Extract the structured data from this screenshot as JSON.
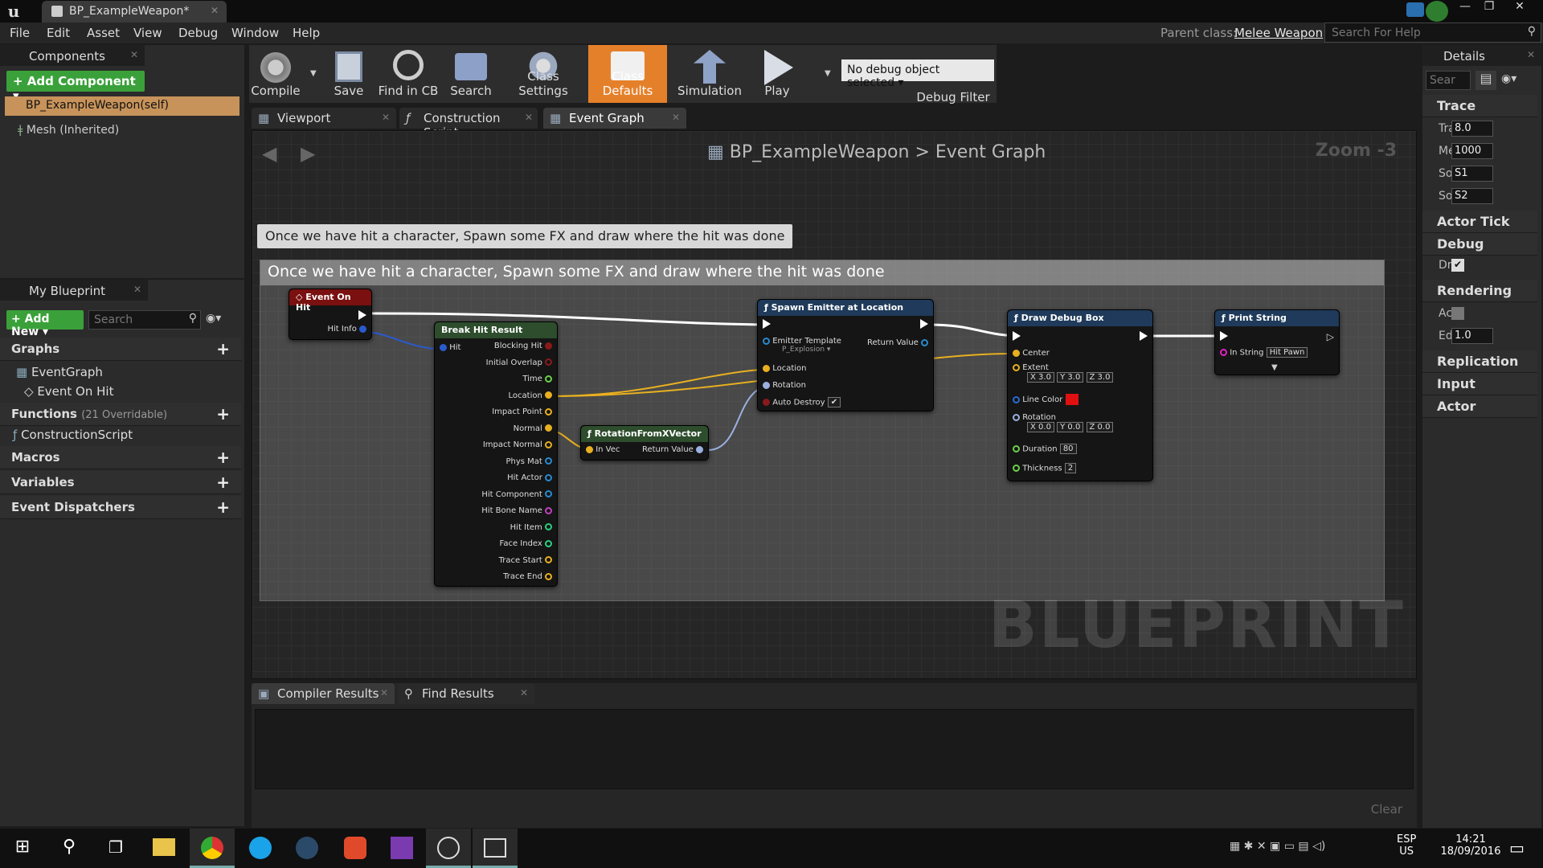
{
  "window": {
    "tab_title": "BP_ExampleWeapon*"
  },
  "menu": [
    "File",
    "Edit",
    "Asset",
    "View",
    "Debug",
    "Window",
    "Help"
  ],
  "header": {
    "parent_label": "Parent class:",
    "parent_value": "Melee Weapon",
    "search_placeholder": "Search For Help"
  },
  "components": {
    "tab": "Components",
    "add_button": "+ Add Component ▾",
    "self_item": "BP_ExampleWeapon(self)",
    "mesh_item": "Mesh (Inherited)"
  },
  "my_blueprint": {
    "tab": "My Blueprint",
    "add_new": "+ Add New ▾",
    "search_placeholder": "Search",
    "graphs": "Graphs",
    "eventgraph": "EventGraph",
    "event_on_hit": "Event On Hit",
    "functions": "Functions",
    "functions_hint": "(21 Overridable)",
    "construction": "ConstructionScript",
    "macros": "Macros",
    "variables": "Variables",
    "dispatchers": "Event Dispatchers"
  },
  "toolbar": {
    "compile": "Compile",
    "save": "Save",
    "find_in_cb": "Find in CB",
    "search": "Search",
    "class_settings": "Class Settings",
    "class_defaults": "Class Defaults",
    "simulation": "Simulation",
    "play": "Play",
    "debug_select": "No debug object selected ▾",
    "debug_filter": "Debug Filter"
  },
  "editor_tabs": [
    "Viewport",
    "Construction Script",
    "Event Graph"
  ],
  "graph": {
    "crumb_bp": "BP_ExampleWeapon",
    "crumb_sep": ">",
    "crumb_graph": "Event Graph",
    "zoom": "Zoom -3",
    "comment": "Once we have hit a character, Spawn some FX and draw where the hit was done",
    "watermark": "BLUEPRINT"
  },
  "nodes": {
    "event_on_hit": {
      "title": "Event On Hit",
      "hit_info": "Hit Info"
    },
    "break_hit": {
      "title": "Break Hit Result",
      "in": "Hit",
      "outs": [
        "Blocking Hit",
        "Initial Overlap",
        "Time",
        "Location",
        "Impact Point",
        "Normal",
        "Impact Normal",
        "Phys Mat",
        "Hit Actor",
        "Hit Component",
        "Hit Bone Name",
        "Hit Item",
        "Face Index",
        "Trace Start",
        "Trace End"
      ]
    },
    "rotation": {
      "title": "RotationFromXVector",
      "in": "In Vec",
      "out": "Return Value"
    },
    "spawn": {
      "title": "Spawn Emitter at Location",
      "emitter": "Emitter Template",
      "emitter_val": "P_Explosion ▾",
      "return": "Return Value",
      "location": "Location",
      "rotation": "Rotation",
      "auto": "Auto Destroy"
    },
    "debug_box": {
      "title": "Draw Debug Box",
      "center": "Center",
      "extent": "Extent",
      "extent_vals": [
        "X 3.0",
        "Y 3.0",
        "Z 3.0"
      ],
      "line_color": "Line Color",
      "rotation": "Rotation",
      "rot_vals": [
        "X 0.0",
        "Y 0.0",
        "Z 0.0"
      ],
      "duration": "Duration",
      "duration_val": "80",
      "thickness": "Thickness",
      "thickness_val": "2"
    },
    "print": {
      "title": "Print String",
      "in_string": "In String",
      "in_string_val": "Hit Pawn"
    }
  },
  "bottom": {
    "tabs": [
      "Compiler Results",
      "Find Results"
    ],
    "clear": "Clear"
  },
  "details": {
    "tab": "Details",
    "search_placeholder": "Sear",
    "trace": "Trace",
    "props": [
      {
        "label": "Tra",
        "value": "8.0"
      },
      {
        "label": "Mel",
        "value": "1000"
      },
      {
        "label": "Soc",
        "value": "S1"
      },
      {
        "label": "Soc",
        "value": "S2"
      }
    ],
    "actor_tick": "Actor Tick",
    "debug": "Debug",
    "debug_prop": "Dra",
    "rendering": "Rendering",
    "act": "Act",
    "edit": "Edit",
    "edit_val": "1.0",
    "replication": "Replication",
    "input": "Input",
    "actor": "Actor"
  },
  "taskbar": {
    "lang1": "ESP",
    "lang2": "US",
    "time": "14:21",
    "date": "18/09/2016"
  },
  "colors": {
    "accent": "#e5802a",
    "green": "#3aa13a",
    "event_red": "#7a1010",
    "func_blue": "#1f3a5a"
  }
}
